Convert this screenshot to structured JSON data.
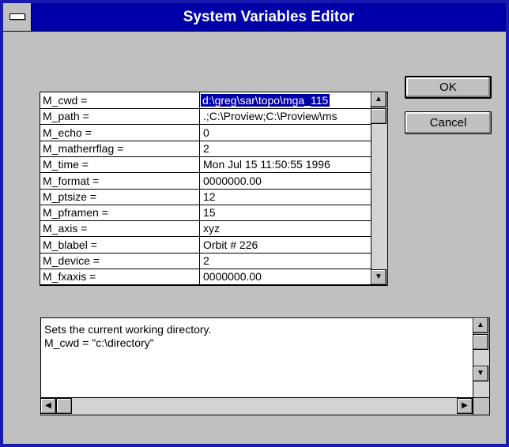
{
  "window": {
    "title": "System Variables Editor"
  },
  "variables": [
    {
      "name": "M_cwd =",
      "value": "d:\\greg\\sar\\topo\\mga_115"
    },
    {
      "name": "M_path =",
      "value": ".;C:\\Proview;C:\\Proview\\ms"
    },
    {
      "name": "M_echo =",
      "value": "0"
    },
    {
      "name": "M_matherrflag =",
      "value": "2"
    },
    {
      "name": "M_time =",
      "value": "Mon Jul 15 11:50:55 1996"
    },
    {
      "name": "M_format =",
      "value": "0000000.00"
    },
    {
      "name": "M_ptsize =",
      "value": "12"
    },
    {
      "name": "M_pframen =",
      "value": "15"
    },
    {
      "name": "M_axis =",
      "value": "xyz"
    },
    {
      "name": "M_blabel =",
      "value": "Orbit # 226"
    },
    {
      "name": "M_device =",
      "value": "2"
    },
    {
      "name": "M_fxaxis =",
      "value": "0000000.00"
    }
  ],
  "selected_index": 0,
  "buttons": {
    "ok": "OK",
    "cancel": "Cancel"
  },
  "description": {
    "line1": "Sets the current working directory.",
    "line2": "M_cwd = \"c:\\directory\""
  },
  "icons": {
    "up": "up-arrow-icon",
    "down": "down-arrow-icon",
    "left": "left-arrow-icon",
    "right": "right-arrow-icon"
  },
  "colors": {
    "title_bar": "#0000a8",
    "window_border": "#1a1ab0",
    "face": "#c0c0c0",
    "selection": "#0000a8"
  }
}
